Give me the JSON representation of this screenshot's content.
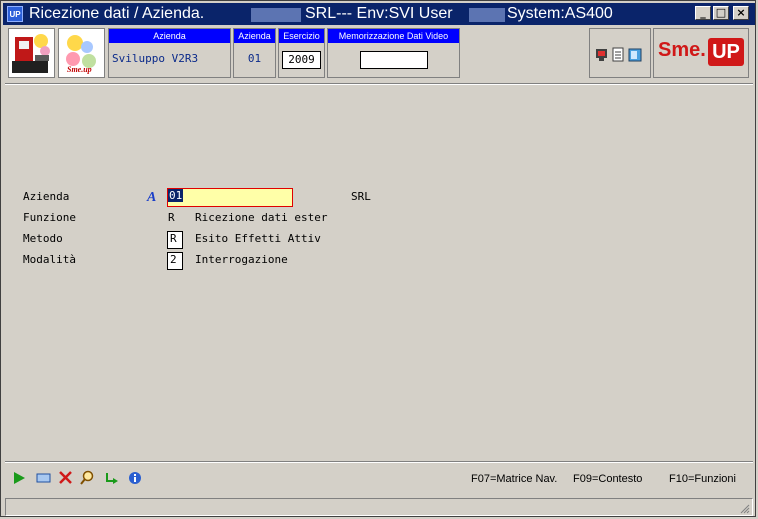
{
  "window": {
    "app_icon_text": "UP",
    "title": "Ricezione dati  / Azienda.",
    "company": "SRL--- Env:SVI User",
    "system": "System:AS400",
    "minimize": "_",
    "maximize": "□",
    "close": "×"
  },
  "header": {
    "logo_text": "Sme.up",
    "azienda_desc": {
      "label": "Azienda",
      "value": "Sviluppo V2R3"
    },
    "azienda_code": {
      "label": "Azienda",
      "value": "01"
    },
    "esercizio": {
      "label": "Esercizio",
      "value": "2009"
    },
    "memorizzazione": {
      "label": "Memorizzazione Dati Video",
      "value": ""
    },
    "brand": {
      "text": "Sme.",
      "badge": "UP"
    }
  },
  "form": {
    "rows": [
      {
        "label": "Azienda",
        "value": "01",
        "desc": "SRL"
      },
      {
        "label": "Funzione",
        "value": "R",
        "desc": "Ricezione dati ester"
      },
      {
        "label": "Metodo",
        "value": "R",
        "desc": "Esito Effetti Attiv"
      },
      {
        "label": "Modalità",
        "value": "2",
        "desc": "Interrogazione"
      }
    ]
  },
  "footer": {
    "icons": [
      "play-icon",
      "window-icon",
      "delete-icon",
      "search-icon",
      "refresh-icon",
      "info-icon"
    ],
    "fkeys": [
      {
        "label": "F07=Matrice Nav."
      },
      {
        "label": "F09=Contesto"
      },
      {
        "label": "F10=Funzioni"
      }
    ]
  }
}
